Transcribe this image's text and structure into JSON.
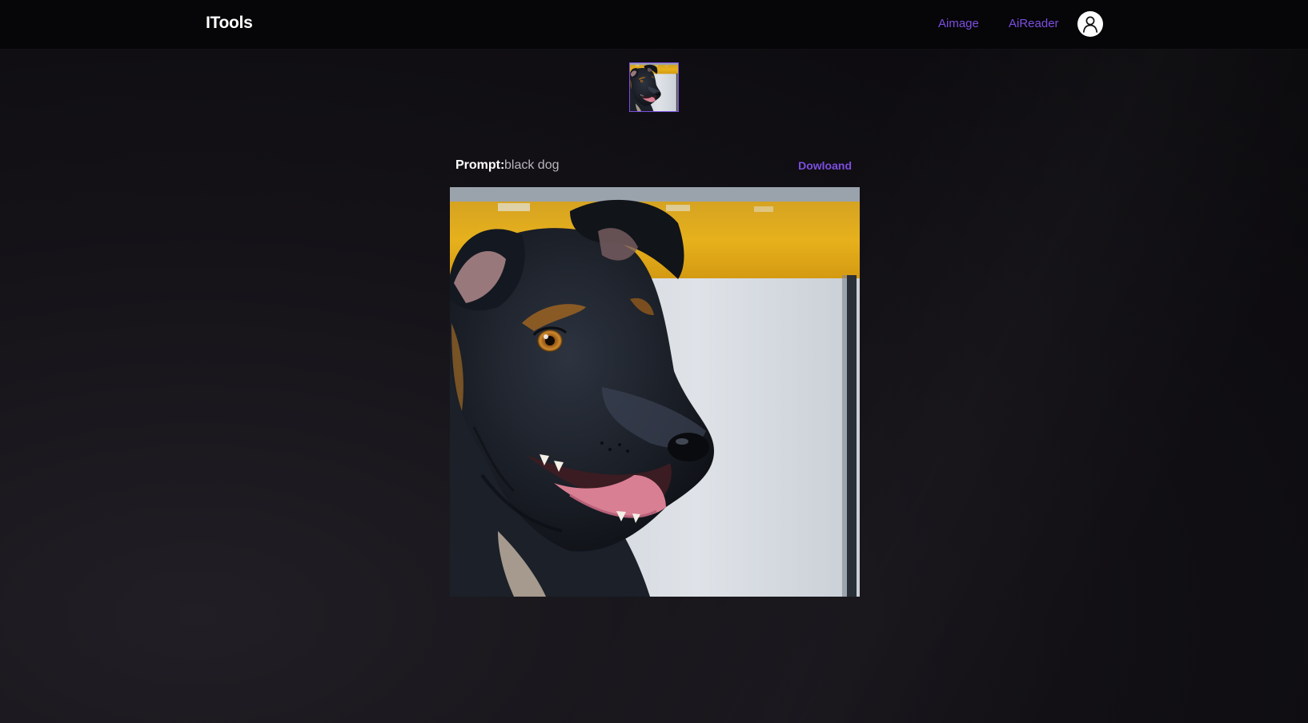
{
  "header": {
    "brand": "ITools",
    "nav": [
      {
        "label": "Aimage"
      },
      {
        "label": "AiReader"
      }
    ],
    "avatar_icon": "user-icon"
  },
  "gallery": {
    "thumbnail_alt": "black dog"
  },
  "result": {
    "prompt_label": "Prompt:",
    "prompt_value": "black dog",
    "download_label": "Dowloand",
    "image_alt": "black dog"
  },
  "colors": {
    "accent": "#7c4ee0",
    "navbar_bg": "#060507",
    "page_bg": "#141217"
  },
  "icons": [
    "user-icon"
  ]
}
